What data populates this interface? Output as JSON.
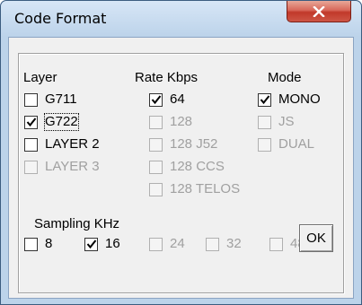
{
  "window": {
    "title": "Code Format",
    "close_icon": "close-icon"
  },
  "headers": {
    "layer": "Layer",
    "rate": "Rate Kbps",
    "mode": "Mode",
    "sampling": "Sampling KHz"
  },
  "layer": [
    {
      "label": "G711",
      "checked": false,
      "enabled": true
    },
    {
      "label": "G722",
      "checked": true,
      "enabled": true
    },
    {
      "label": "LAYER 2",
      "checked": false,
      "enabled": true
    },
    {
      "label": "LAYER 3",
      "checked": false,
      "enabled": false
    }
  ],
  "rate": [
    {
      "label": "64",
      "checked": true,
      "enabled": true
    },
    {
      "label": "128",
      "checked": false,
      "enabled": false
    },
    {
      "label": "128 J52",
      "checked": false,
      "enabled": false
    },
    {
      "label": "128 CCS",
      "checked": false,
      "enabled": false
    },
    {
      "label": "128 TELOS",
      "checked": false,
      "enabled": false
    }
  ],
  "mode": [
    {
      "label": "MONO",
      "checked": true,
      "enabled": true
    },
    {
      "label": "JS",
      "checked": false,
      "enabled": false
    },
    {
      "label": "DUAL",
      "checked": false,
      "enabled": false
    }
  ],
  "sampling": [
    {
      "label": "8",
      "checked": false,
      "enabled": true
    },
    {
      "label": "16",
      "checked": true,
      "enabled": true
    },
    {
      "label": "24",
      "checked": false,
      "enabled": false
    },
    {
      "label": "32",
      "checked": false,
      "enabled": false
    },
    {
      "label": "48",
      "checked": false,
      "enabled": false
    }
  ],
  "ok_label": "OK"
}
